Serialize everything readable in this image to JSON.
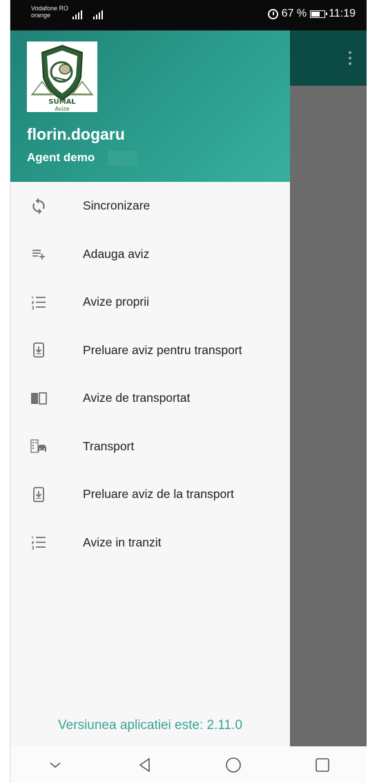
{
  "status_bar": {
    "carrier_line1": "Vodafone RO",
    "carrier_line2": "orange",
    "battery_percent": "67 %",
    "time": "11:19"
  },
  "drawer": {
    "user_name": "florin.dogaru",
    "user_role": "Agent demo",
    "logo_text_1": "SUMAL",
    "logo_text_2": "Avize",
    "menu_items": [
      {
        "label": "Sincronizare",
        "icon": "sync-icon"
      },
      {
        "label": "Adauga aviz",
        "icon": "playlist-add-icon"
      },
      {
        "label": "Avize proprii",
        "icon": "numbered-list-icon"
      },
      {
        "label": "Preluare aviz pentru transport",
        "icon": "download-device-icon"
      },
      {
        "label": "Avize de transportat",
        "icon": "book-icon"
      },
      {
        "label": "Transport",
        "icon": "building-car-icon"
      },
      {
        "label": "Preluare aviz de la transport",
        "icon": "download-device-icon"
      },
      {
        "label": "Avize in tranzit",
        "icon": "numbered-list-icon"
      }
    ],
    "version_text": "Versiunea aplicatiei este: 2.11.0"
  },
  "colors": {
    "header_teal": "#2a9a8a",
    "appbar": "#0c4a45",
    "scrim": "#6b6b6b",
    "version_text": "#3aa393"
  }
}
